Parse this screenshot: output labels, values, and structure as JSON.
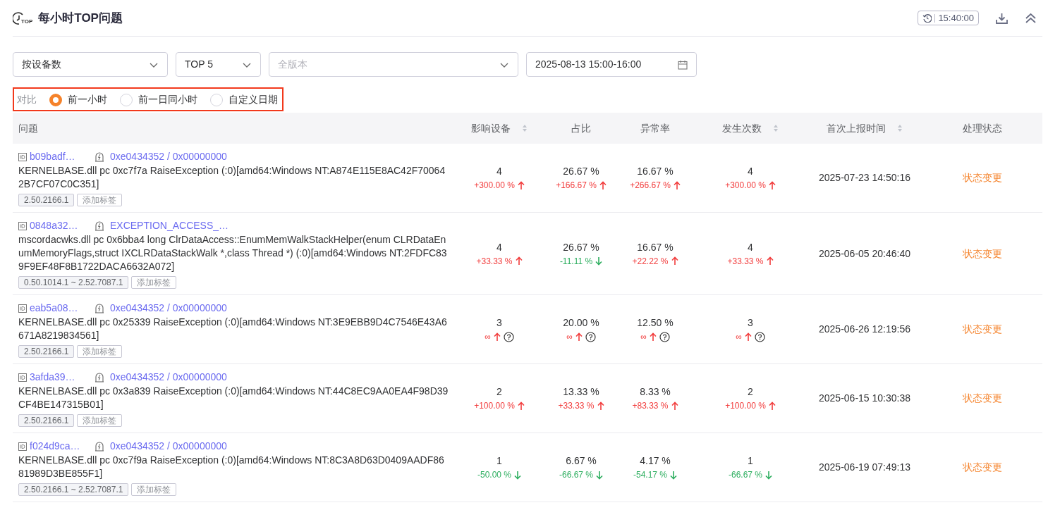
{
  "header": {
    "icon_label": "TOP",
    "title": "每小时TOP问题",
    "time_badge": "15:40:00"
  },
  "filters": [
    {
      "kind": "select",
      "value": "按设备数"
    },
    {
      "kind": "select",
      "value": "TOP 5"
    },
    {
      "kind": "select",
      "placeholder": "全版本"
    },
    {
      "kind": "date",
      "value": "2025-08-13 15:00-16:00"
    }
  ],
  "compare": {
    "label": "对比",
    "options": [
      {
        "label": "前一小时",
        "selected": true
      },
      {
        "label": "前一日同小时",
        "selected": false
      },
      {
        "label": "自定义日期",
        "selected": false
      }
    ]
  },
  "table": {
    "columns": [
      {
        "label": "问题",
        "sortable": false
      },
      {
        "label": "影响设备",
        "sortable": true
      },
      {
        "label": "占比",
        "sortable": false
      },
      {
        "label": "异常率",
        "sortable": false
      },
      {
        "label": "发生次数",
        "sortable": true
      },
      {
        "label": "首次上报时间",
        "sortable": true
      },
      {
        "label": "处理状态",
        "sortable": false
      }
    ],
    "rows": [
      {
        "id": "b09badf…",
        "code": "0xe0434352 / 0x00000000",
        "description": "KERNELBASE.dll pc 0xc7f7a RaiseException (:0)[amd64:Windows NT:A874E115E8AC42F700642B7CF07C0C351]",
        "version": "2.50.2166.1",
        "tag_button": "添加标签",
        "metrics": [
          {
            "value": "4",
            "change": "+300.00 %",
            "rising": true,
            "help": false
          },
          {
            "value": "26.67 %",
            "change": "+166.67 %",
            "rising": true,
            "help": false
          },
          {
            "value": "16.67 %",
            "change": "+266.67 %",
            "rising": true,
            "help": false
          },
          {
            "value": "4",
            "change": "+300.00 %",
            "rising": true,
            "help": false
          }
        ],
        "first_reported": "2025-07-23 14:50:16",
        "action": "状态变更"
      },
      {
        "id": "0848a32…",
        "code": "EXCEPTION_ACCESS_…",
        "description": "mscordacwks.dll pc 0x6bba4 long ClrDataAccess::EnumMemWalkStackHelper(enum CLRDataEnumMemoryFlags,struct IXCLRDataStackWalk *,class Thread *) (:0)[amd64:Windows NT:2FDFC839F9EF48F8B1722DACA6632A072]",
        "version": "0.50.1014.1 ~ 2.52.7087.1",
        "tag_button": "添加标签",
        "metrics": [
          {
            "value": "4",
            "change": "+33.33 %",
            "rising": true,
            "help": false
          },
          {
            "value": "26.67 %",
            "change": "-11.11 %",
            "rising": false,
            "help": false
          },
          {
            "value": "16.67 %",
            "change": "+22.22 %",
            "rising": true,
            "help": false
          },
          {
            "value": "4",
            "change": "+33.33 %",
            "rising": true,
            "help": false
          }
        ],
        "first_reported": "2025-06-05 20:46:40",
        "action": "状态变更"
      },
      {
        "id": "eab5a08…",
        "code": "0xe0434352 / 0x00000000",
        "description": "KERNELBASE.dll pc 0x25339 RaiseException (:0)[amd64:Windows NT:3E9EBB9D4C7546E43A6671A8219834561]",
        "version": "2.50.2166.1",
        "tag_button": "添加标签",
        "metrics": [
          {
            "value": "3",
            "change": "∞",
            "rising": true,
            "help": true
          },
          {
            "value": "20.00 %",
            "change": "∞",
            "rising": true,
            "help": true
          },
          {
            "value": "12.50 %",
            "change": "∞",
            "rising": true,
            "help": true
          },
          {
            "value": "3",
            "change": "∞",
            "rising": true,
            "help": true
          }
        ],
        "first_reported": "2025-06-26 12:19:56",
        "action": "状态变更"
      },
      {
        "id": "3afda39…",
        "code": "0xe0434352 / 0x00000000",
        "description": "KERNELBASE.dll pc 0x3a839 RaiseException (:0)[amd64:Windows NT:44C8EC9AA0EA4F98D39CF4BE147315B01]",
        "version": "2.50.2166.1",
        "tag_button": "添加标签",
        "metrics": [
          {
            "value": "2",
            "change": "+100.00 %",
            "rising": true,
            "help": false
          },
          {
            "value": "13.33 %",
            "change": "+33.33 %",
            "rising": true,
            "help": false
          },
          {
            "value": "8.33 %",
            "change": "+83.33 %",
            "rising": true,
            "help": false
          },
          {
            "value": "2",
            "change": "+100.00 %",
            "rising": true,
            "help": false
          }
        ],
        "first_reported": "2025-06-15 10:30:38",
        "action": "状态变更"
      },
      {
        "id": "f024d9ca…",
        "code": "0xe0434352 / 0x00000000",
        "description": "KERNELBASE.dll pc 0xc7f9a RaiseException (:0)[amd64:Windows NT:8C3A8D63D0409AADF8681989D3BE855F1]",
        "version": "2.50.2166.1 ~ 2.52.7087.1",
        "tag_button": "添加标签",
        "metrics": [
          {
            "value": "1",
            "change": "-50.00 %",
            "rising": false,
            "help": false
          },
          {
            "value": "6.67 %",
            "change": "-66.67 %",
            "rising": false,
            "help": false
          },
          {
            "value": "4.17 %",
            "change": "-54.17 %",
            "rising": false,
            "help": false
          },
          {
            "value": "1",
            "change": "-66.67 %",
            "rising": false,
            "help": false
          }
        ],
        "first_reported": "2025-06-19 07:49:13",
        "action": "状态变更"
      }
    ]
  }
}
